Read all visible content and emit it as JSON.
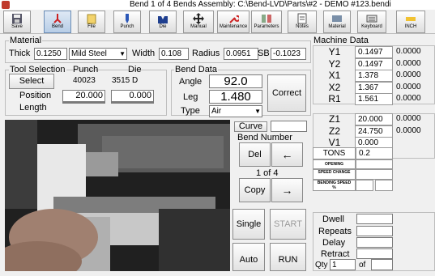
{
  "window": {
    "title": "Bend 1 of 4 Bends  Assembly: C:\\Bend-LVD\\Parts\\#2 - DEMO #123.bendi"
  },
  "toolbar": {
    "save": "Save",
    "bend": "Bend",
    "file": "File",
    "punch": "Punch",
    "die": "Die",
    "manual": "Manual",
    "maintenance": "Maintenance",
    "parameters": "Parameters",
    "notes": "Notes",
    "material": "Material",
    "keyboard": "Keyboard",
    "inch": "INCH"
  },
  "material": {
    "section_label": "Material",
    "thick_label": "Thick",
    "thick_value": "0.1250",
    "type_value": "Mild Steel",
    "width_label": "Width",
    "width_value": "0.108",
    "radius_label": "Radius",
    "radius_value": "0.0951",
    "sb_label": "SB",
    "sb_value": "-0.1023"
  },
  "tool_selection": {
    "section_label": "Tool Selection",
    "punch_header": "Punch",
    "die_header": "Die",
    "select_label": "Select",
    "punch_id": "40023",
    "die_id": "3515 D",
    "position_label": "Position",
    "punch_position": "20.000",
    "die_position": "0.000",
    "length_label": "Length",
    "punch_length": "",
    "die_length": ""
  },
  "bend_data": {
    "section_label": "Bend Data",
    "angle_label": "Angle",
    "angle_value": "92.0",
    "leg_label": "Leg",
    "leg_value": "1.480",
    "type_label": "Type",
    "type_value": "Air",
    "correct_label": "Correct"
  },
  "controls": {
    "curve_label": "Curve",
    "curve_value": "",
    "bend_number_label": "Bend Number",
    "del_label": "Del",
    "copy_label": "Copy",
    "prev_arrow": "←",
    "next_arrow": "→",
    "bend_counter": "1 of 4",
    "single_label": "Single",
    "start_label": "START",
    "auto_label": "Auto",
    "run_label": "RUN"
  },
  "machine_data": {
    "section_label": "Machine Data",
    "axes": [
      {
        "name": "Y1",
        "value": "0.1497",
        "offset": "0.0000"
      },
      {
        "name": "Y2",
        "value": "0.1497",
        "offset": "0.0000"
      },
      {
        "name": "X1",
        "value": "1.378",
        "offset": "0.0000"
      },
      {
        "name": "X2",
        "value": "1.367",
        "offset": "0.0000"
      },
      {
        "name": "R1",
        "value": "1.561",
        "offset": "0.0000"
      }
    ],
    "axes2": [
      {
        "name": "Z1",
        "value": "20.000",
        "offset": "0.0000"
      },
      {
        "name": "Z2",
        "value": "24.750",
        "offset": "0.0000"
      },
      {
        "name": "V1",
        "value": "0.000",
        "offset": ""
      }
    ],
    "tons_label": "TONS",
    "tons_value": "0.2",
    "opening_label": "OPENING",
    "speed_change_label": "SPEED CHANGE",
    "bending_speed_label": "BENDING SPEED %",
    "dwell_label": "Dwell",
    "repeats_label": "Repeats",
    "delay_label": "Delay",
    "retract_label": "Retract",
    "qty_label": "Qty",
    "qty_value": "1",
    "of_label": "of"
  }
}
